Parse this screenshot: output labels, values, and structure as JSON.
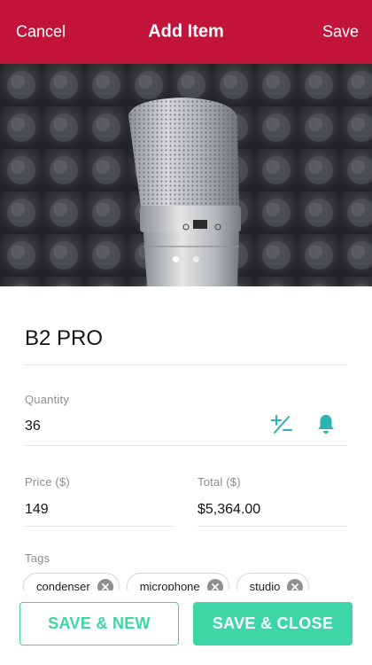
{
  "nav": {
    "cancel_label": "Cancel",
    "title": "Add Item",
    "save_label": "Save"
  },
  "carousel": {
    "image": "condenser-microphone-photo",
    "pages": 2,
    "current_page": 1
  },
  "item": {
    "name": "B2 PRO"
  },
  "quantity": {
    "label": "Quantity",
    "value": "36",
    "adjust_icon": "plus-minus-icon",
    "alert_icon": "bell-icon"
  },
  "price": {
    "label": "Price ($)",
    "value": "149"
  },
  "total": {
    "label": "Total ($)",
    "value": "$5,364.00"
  },
  "tags": {
    "label": "Tags",
    "items": [
      "condenser",
      "microphone",
      "studio"
    ]
  },
  "actions": {
    "save_new_label": "SAVE & NEW",
    "save_close_label": "SAVE & CLOSE"
  },
  "colors": {
    "brand": "#c2143b",
    "accent": "#3dd6a4",
    "icon": "#2bb3b3"
  }
}
